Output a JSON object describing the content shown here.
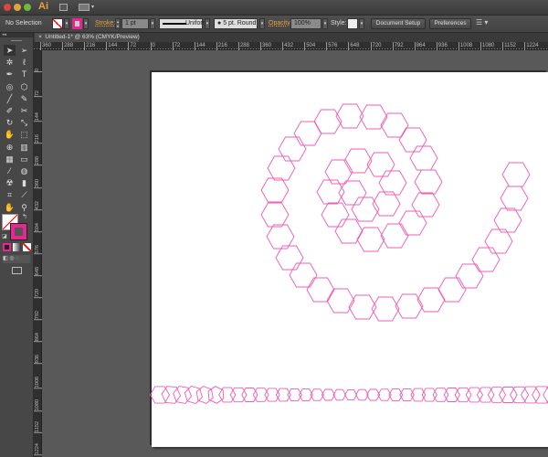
{
  "app": {
    "logo": "Ai",
    "icons": [
      "bridge-icon",
      "arrange-documents-icon"
    ]
  },
  "control_bar": {
    "selection": "No Selection",
    "stroke_label": "Stroke:",
    "stroke_weight": "1 pt",
    "stroke_profile": "Uniform",
    "brush": "5 pt. Round",
    "opacity_label": "Opacity:",
    "opacity": "100%",
    "style_label": "Style:",
    "document_setup": "Document Setup",
    "preferences": "Preferences"
  },
  "document": {
    "tab_title": "Untitled-1* @ 63% (CMYK/Preview)",
    "close": "×"
  },
  "rulers": {
    "horizontal": [
      "360",
      "288",
      "216",
      "144",
      "72",
      "0",
      "72",
      "144",
      "216",
      "288",
      "360",
      "432",
      "504",
      "576",
      "648",
      "720",
      "792",
      "864",
      "936",
      "1008",
      "1080",
      "1152",
      "1224"
    ],
    "vertical": [
      "0",
      "72",
      "144",
      "216",
      "288",
      "360",
      "432",
      "504",
      "576",
      "648",
      "720",
      "792",
      "864",
      "936",
      "1008",
      "1080",
      "1152",
      "1224"
    ]
  },
  "tools": [
    "selection",
    "direct-selection",
    "magic-wand",
    "lasso",
    "pen",
    "type",
    "spiral",
    "polygon",
    "paintbrush",
    "pencil",
    "blob-brush",
    "scissors",
    "rotate",
    "scale",
    "warp",
    "free-transform",
    "shape-builder",
    "graph",
    "mesh",
    "gradient",
    "eyedropper",
    "blend",
    "symbol-sprayer",
    "column-graph",
    "artboard",
    "slice",
    "hand",
    "zoom"
  ],
  "colors": {
    "stroke": "#e8268f",
    "artwork": "#ee5cb4",
    "orange": "#e8a33a"
  }
}
